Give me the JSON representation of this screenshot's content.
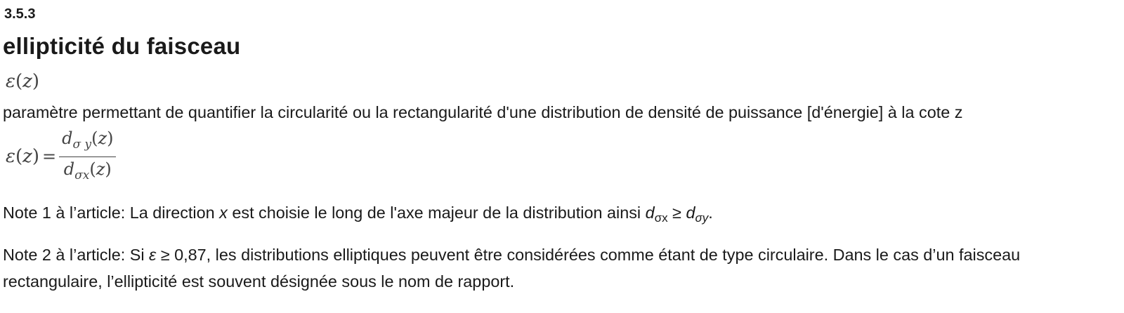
{
  "term": {
    "number": "3.5.3",
    "title": "ellipticité du faisceau",
    "symbol": {
      "letter": "ε",
      "argument": "z"
    },
    "definition": "paramètre permettant de quantifier la circularité ou la rectangularité d'une distribution de densité de puissance [d'énergie] à la cote z",
    "formula": {
      "lhs_letter": "ε",
      "argument": "z",
      "equals": "=",
      "numerator": {
        "letter": "d",
        "subscript": "σ y"
      },
      "denominator": {
        "letter": "d",
        "subscript": "σx"
      }
    }
  },
  "notes": {
    "note1": {
      "label": "Note 1 à l’article:",
      "text_before": "La direction",
      "variable": "x",
      "text_after": "est choisie le long de l'axe majeur de la distribution ainsi",
      "expr_left_letter": "d",
      "expr_left_sub": "σx",
      "operator": "≥",
      "expr_right_letter": "d",
      "expr_right_sub": "σy",
      "end": "."
    },
    "note2": {
      "label": "Note 2 à l’article:",
      "text_before": "Si",
      "variable": "ε",
      "text_after": "≥ 0,87, les distributions elliptiques peuvent être considérées comme étant de type circulaire. Dans le cas d’un faisceau rectangulaire, l’ellipticité est souvent désignée sous le nom de rapport."
    }
  }
}
